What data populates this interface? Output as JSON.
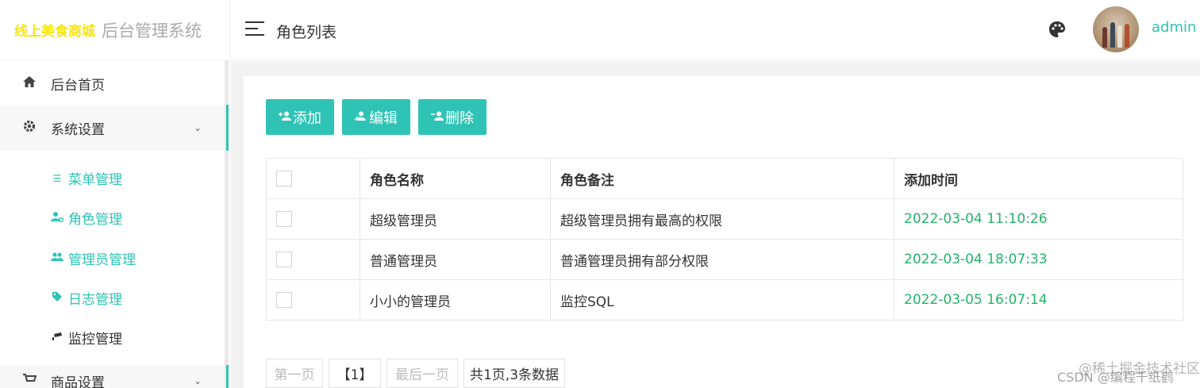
{
  "logo": {
    "brand": "线上美食商城",
    "system": "后台管理系统"
  },
  "sidebar": {
    "home": {
      "label": "后台首页",
      "icon": "home-icon"
    },
    "system": {
      "label": "系统设置",
      "icon": "gear-icon",
      "expanded": true
    },
    "sub_items": [
      {
        "label": "菜单管理",
        "icon": "list-icon",
        "active": false
      },
      {
        "label": "角色管理",
        "icon": "user-settings-icon",
        "active": false
      },
      {
        "label": "管理员管理",
        "icon": "users-icon",
        "active": false
      },
      {
        "label": "日志管理",
        "icon": "tag-icon",
        "active": false
      },
      {
        "label": "监控管理",
        "icon": "camera-icon",
        "active": false
      }
    ],
    "goods": {
      "label": "商品设置",
      "icon": "cart-icon"
    }
  },
  "header": {
    "title": "角色列表",
    "user": "admin"
  },
  "toolbar": {
    "add": "添加",
    "edit": "编辑",
    "delete": "删除"
  },
  "table": {
    "columns": [
      "角色名称",
      "角色备注",
      "添加时间"
    ],
    "rows": [
      {
        "name": "超级管理员",
        "remark": "超级管理员拥有最高的权限",
        "time": "2022-03-04 11:10:26"
      },
      {
        "name": "普通管理员",
        "remark": "普通管理员拥有部分权限",
        "time": "2022-03-04 18:07:33"
      },
      {
        "name": "小小的管理员",
        "remark": "监控SQL",
        "time": "2022-03-05 16:07:14"
      }
    ]
  },
  "pagination": {
    "first": "第一页",
    "current": "【1】",
    "last": "最后一页",
    "summary": "共1页,3条数据"
  },
  "watermark": {
    "line1": "@稀土掘金技术社区",
    "line2": "CSDN @编程千纸鹤"
  },
  "colors": {
    "accent": "#2ec3b5",
    "time": "#23b36b",
    "brand": "#f5e416"
  }
}
